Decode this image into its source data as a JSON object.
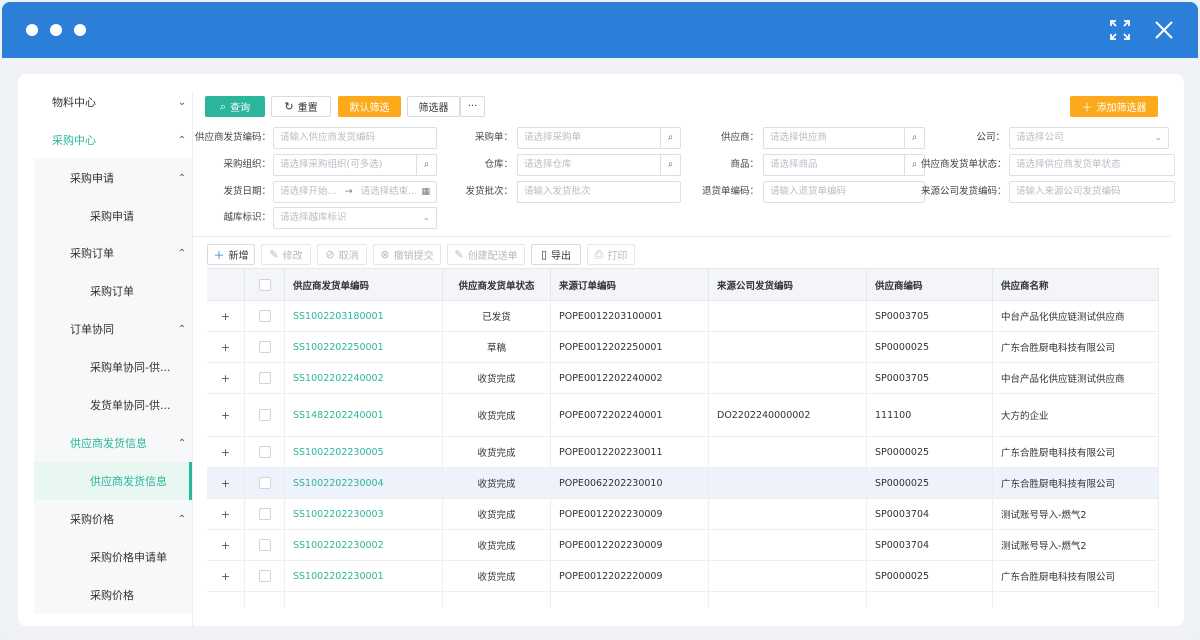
{
  "sidebar": {
    "items": [
      {
        "label": "物料中心",
        "chevron": "⌄"
      },
      {
        "label": "采购中心",
        "chevron": "⌃"
      },
      {
        "label": "采购申请",
        "chevron": "⌃"
      },
      {
        "label": "采购申请",
        "chevron": ""
      },
      {
        "label": "采购订单",
        "chevron": "⌃"
      },
      {
        "label": "采购订单",
        "chevron": ""
      },
      {
        "label": "订单协同",
        "chevron": "⌃"
      },
      {
        "label": "采购单协同-供...",
        "chevron": ""
      },
      {
        "label": "发货单协同-供...",
        "chevron": ""
      },
      {
        "label": "供应商发货信息",
        "chevron": "⌃"
      },
      {
        "label": "供应商发货信息",
        "chevron": ""
      },
      {
        "label": "采购价格",
        "chevron": "⌃"
      },
      {
        "label": "采购价格申请单",
        "chevron": ""
      },
      {
        "label": "采购价格",
        "chevron": ""
      }
    ]
  },
  "toolbar": {
    "query": "查询",
    "reset": "重置",
    "default_filter": "默认筛选",
    "filter": "筛选器",
    "more": "···",
    "add_filter": "添加筛选器"
  },
  "filters": {
    "supplier_ship_code": {
      "label": "供应商发货编码：",
      "placeholder": "请输入供应商发货编码"
    },
    "purchase_order": {
      "label": "采购单：",
      "placeholder": "请选择采购单"
    },
    "supplier": {
      "label": "供应商：",
      "placeholder": "请选择供应商"
    },
    "company": {
      "label": "公司：",
      "placeholder": "请选择公司"
    },
    "purchase_org": {
      "label": "采购组织：",
      "placeholder": "请选择采购组织(可多选)"
    },
    "warehouse": {
      "label": "仓库：",
      "placeholder": "请选择仓库"
    },
    "goods": {
      "label": "商品：",
      "placeholder": "请选择商品"
    },
    "ship_status": {
      "label": "供应商发货单状态：",
      "placeholder": "请选择供应商发货单状态"
    },
    "ship_date": {
      "label": "发货日期：",
      "start": "请选择开始...",
      "sep": "→",
      "end": "请选择结束..."
    },
    "ship_batch": {
      "label": "发货批次：",
      "placeholder": "请输入发货批次"
    },
    "return_code": {
      "label": "退货单编码：",
      "placeholder": "请输入退货单编码"
    },
    "source_ship_code": {
      "label": "来源公司发货编码：",
      "placeholder": "请输入来源公司发货编码"
    },
    "over_stock": {
      "label": "越库标识：",
      "placeholder": "请选择越库标识"
    }
  },
  "actions": {
    "new": "新增",
    "edit": "修改",
    "cancel": "取消",
    "revoke": "撤销提交",
    "create_delivery": "创建配送单",
    "export": "导出",
    "print": "打印"
  },
  "table": {
    "columns": [
      "供应商发货单编码",
      "供应商发货单状态",
      "来源订单编码",
      "来源公司发货编码",
      "供应商编码",
      "供应商名称"
    ],
    "rows": [
      [
        "SS1002203180001",
        "已发货",
        "POPE0012203100001",
        "",
        "SP0003705",
        "中台产品化供应链测试供应商"
      ],
      [
        "SS1002202250001",
        "草稿",
        "POPE0012202250001",
        "",
        "SP0000025",
        "广东合胜厨电科技有限公司"
      ],
      [
        "SS1002202240002",
        "收货完成",
        "POPE0012202240002",
        "",
        "SP0003705",
        "中台产品化供应链测试供应商"
      ],
      [
        "SS1482202240001",
        "收货完成",
        "POPE0072202240001",
        "DO2202240000002",
        "111100",
        "大方的企业"
      ],
      [
        "SS1002202230005",
        "收货完成",
        "POPE0012202230011",
        "",
        "SP0000025",
        "广东合胜厨电科技有限公司"
      ],
      [
        "SS1002202230004",
        "收货完成",
        "POPE0062202230010",
        "",
        "SP0000025",
        "广东合胜厨电科技有限公司"
      ],
      [
        "SS1002202230003",
        "收货完成",
        "POPE0012202230009",
        "",
        "SP0003704",
        "测试账号导入-燃气2"
      ],
      [
        "SS1002202230002",
        "收货完成",
        "POPE0012202230009",
        "",
        "SP0003704",
        "测试账号导入-燃气2"
      ],
      [
        "SS1002202230001",
        "收货完成",
        "POPE0012202220009",
        "",
        "SP0000025",
        "广东合胜厨电科技有限公司"
      ]
    ]
  },
  "colors": {
    "titlebar": "#2b7fd8",
    "accent": "#2bb59a",
    "orange": "#fbaa1c"
  }
}
